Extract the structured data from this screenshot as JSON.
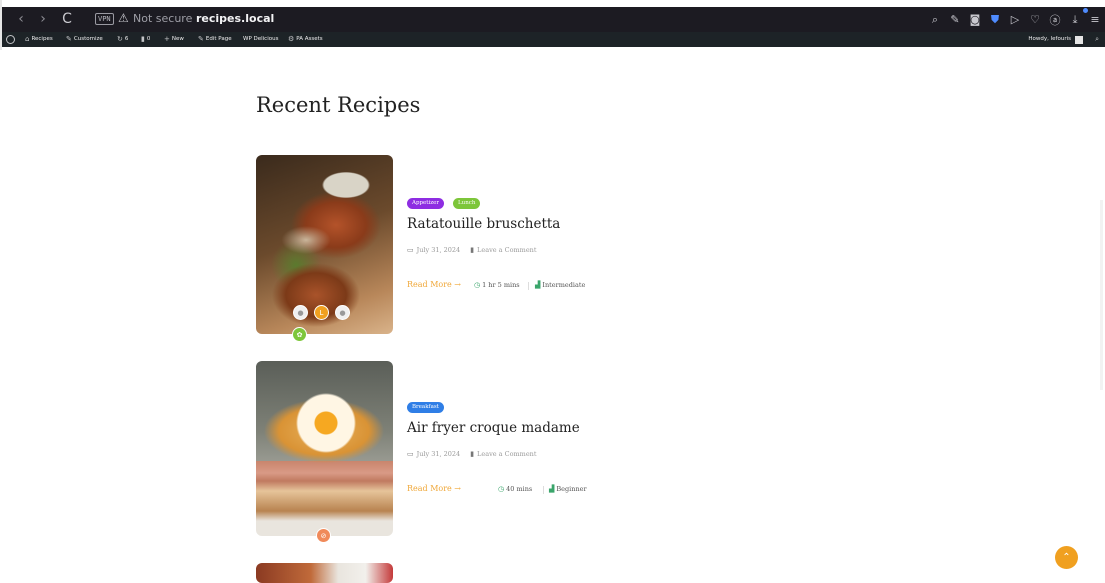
{
  "browser": {
    "nav": {
      "back": "‹",
      "forward": "›",
      "reload": "C"
    },
    "vpn_label": "VPN",
    "security_text": "Not secure",
    "url": "recipes.local",
    "icons": [
      "search-zoom-icon",
      "edit-icon",
      "camera-icon",
      "shield-icon",
      "send-icon",
      "heart-icon",
      "profile-icon",
      "download-icon",
      "menu-icon"
    ]
  },
  "adminbar": {
    "items": [
      "Recipes",
      "Customize",
      "6",
      "0",
      "New",
      "Edit Page",
      "WP Delicious",
      "PA Assets"
    ],
    "howdy": "Howdy, lefouris"
  },
  "page": {
    "title": "Recent Recipes"
  },
  "recipes": [
    {
      "tags": [
        {
          "label": "Appetizer",
          "color": "#8e2de2"
        },
        {
          "label": "Lunch",
          "color": "#7dc63a"
        }
      ],
      "title": "Ratatouille bruschetta",
      "date": "July 31, 2024",
      "comment": "Leave a Comment",
      "read_more": "Read More →",
      "time": "1 hr 5 mins",
      "difficulty": "Intermediate"
    },
    {
      "tags": [
        {
          "label": "Breakfast",
          "color": "#2f7ee6"
        }
      ],
      "title": "Air fryer croque madame",
      "date": "July 31, 2024",
      "comment": "Leave a Comment",
      "read_more": "Read More →",
      "time": "40 mins",
      "difficulty": "Beginner"
    }
  ],
  "colors": {
    "accent": "#f0a020",
    "admin_bar": "#1d2327",
    "browser_bar": "#1c1b22"
  }
}
